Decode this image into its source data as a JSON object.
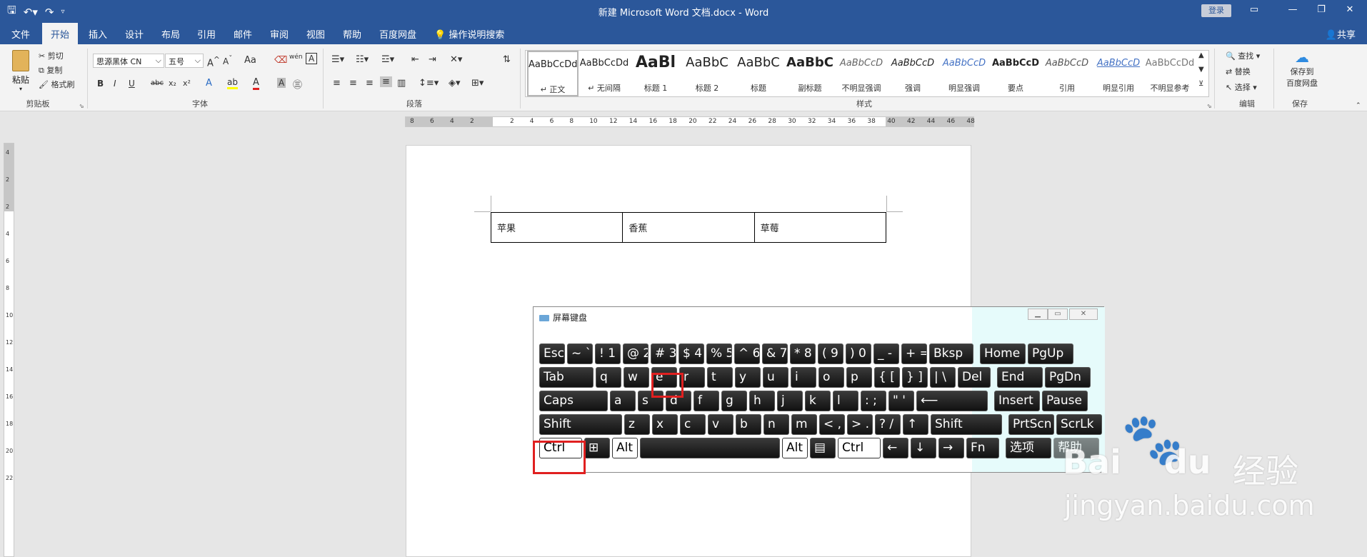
{
  "window": {
    "title": "新建 Microsoft Word 文档.docx  -  Word",
    "login_label": "登录",
    "min_icon": "minimize-icon",
    "restore_icon": "restore-icon",
    "close_icon": "close-icon"
  },
  "quick_access": [
    "save-icon",
    "undo-icon",
    "redo-icon",
    "customize-icon"
  ],
  "menu": {
    "tabs": [
      "文件",
      "开始",
      "插入",
      "设计",
      "布局",
      "引用",
      "邮件",
      "审阅",
      "视图",
      "帮助",
      "百度网盘"
    ],
    "active_tab": "开始",
    "tell_me": "操作说明搜索",
    "share": "共享"
  },
  "ribbon": {
    "clipboard": {
      "paste": "粘贴",
      "cut": "剪切",
      "copy": "复制",
      "format_painter": "格式刷",
      "group_label": "剪贴板"
    },
    "font": {
      "font_name": "思源黑体 CN",
      "font_size": "五号",
      "change_case": "Aa",
      "wen": "wén",
      "group_label": "字体",
      "buttons": [
        "B",
        "I",
        "U",
        "abc",
        "x₂",
        "x²",
        "A",
        "A",
        "A"
      ]
    },
    "paragraph": {
      "group_label": "段落"
    },
    "styles": {
      "group_label": "样式",
      "items": [
        {
          "preview": "AaBbCcDd",
          "name": "↵ 正文"
        },
        {
          "preview": "AaBbCcDd",
          "name": "↵ 无间隔"
        },
        {
          "preview": "AaBl",
          "name": "标题 1"
        },
        {
          "preview": "AaBbC",
          "name": "标题 2"
        },
        {
          "preview": "AaBbC",
          "name": "标题"
        },
        {
          "preview": "AaBbC",
          "name": "副标题"
        },
        {
          "preview": "AaBbCcD",
          "name": "不明显强调"
        },
        {
          "preview": "AaBbCcD",
          "name": "强调"
        },
        {
          "preview": "AaBbCcD",
          "name": "明显强调"
        },
        {
          "preview": "AaBbCcD",
          "name": "要点"
        },
        {
          "preview": "AaBbCcD",
          "name": "引用"
        },
        {
          "preview": "AaBbCcD",
          "name": "明显引用"
        },
        {
          "preview": "AaBbCcDd",
          "name": "不明显参考"
        }
      ]
    },
    "editing": {
      "find": "查找",
      "replace": "替换",
      "select": "选择",
      "group_label": "编辑"
    },
    "save": {
      "label_1": "保存到",
      "label_2": "百度网盘",
      "group_label": "保存"
    }
  },
  "ruler": {
    "h_numbers": [
      "8",
      "6",
      "4",
      "2",
      "2",
      "4",
      "6",
      "8",
      "10",
      "12",
      "14",
      "16",
      "18",
      "20",
      "22",
      "24",
      "26",
      "28",
      "30",
      "32",
      "34",
      "36",
      "38",
      "40",
      "42",
      "44",
      "46",
      "48"
    ],
    "v_numbers": [
      "4",
      "2",
      "2",
      "4",
      "6",
      "8",
      "10",
      "12",
      "14",
      "16",
      "18",
      "20",
      "22"
    ]
  },
  "document": {
    "table": [
      [
        "苹果",
        "香蕉",
        "草莓"
      ]
    ]
  },
  "osk": {
    "title": "屏幕键盘",
    "rows": [
      [
        "Esc",
        "~ `",
        "! 1",
        "@ 2",
        "# 3",
        "$ 4",
        "% 5",
        "^ 6",
        "& 7",
        "* 8",
        "( 9",
        ") 0",
        "_ -",
        "+ =",
        "Bksp",
        "Home",
        "PgUp"
      ],
      [
        "Tab",
        "q",
        "w",
        "e",
        "r",
        "t",
        "y",
        "u",
        "i",
        "o",
        "p",
        "{ [",
        "} ]",
        "| \\",
        "Del",
        "End",
        "PgDn"
      ],
      [
        "Caps",
        "a",
        "s",
        "d",
        "f",
        "g",
        "h",
        "j",
        "k",
        "l",
        ": ;",
        "\" '",
        "⟵",
        "Insert",
        "Pause"
      ],
      [
        "Shift",
        "z",
        "x",
        "c",
        "v",
        "b",
        "n",
        "m",
        "< ,",
        "> .",
        "? /",
        "↑",
        "Shift",
        "PrtScn",
        "ScrLk"
      ],
      [
        "Ctrl",
        "⊞",
        "Alt",
        "",
        "Alt",
        "▤",
        "Ctrl",
        "←",
        "↓",
        "→",
        "Fn",
        "选项",
        "帮助"
      ]
    ],
    "highlighted": [
      "e",
      "Ctrl"
    ]
  },
  "watermark": {
    "brand": "Bai",
    "brand2": "du",
    "cn": "经验",
    "url": "jingyan.baidu.com"
  }
}
